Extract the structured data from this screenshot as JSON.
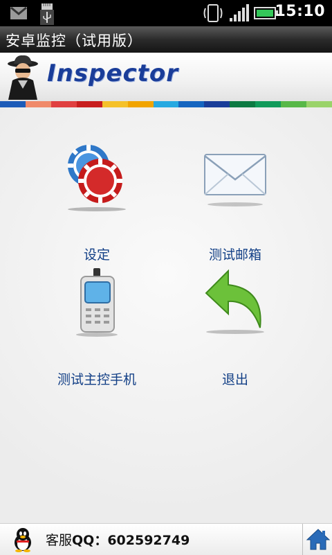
{
  "status_bar": {
    "time": "15:10",
    "icons": [
      "gmail-icon",
      "sd-card-icon",
      "usb-icon",
      "vibrate-icon",
      "signal-icon",
      "battery-icon"
    ]
  },
  "title_bar": {
    "title": "安卓监控（试用版）"
  },
  "brand": {
    "logo_text": "Inspector",
    "logo_icon": "spy-icon"
  },
  "stripe_colors": [
    "#1d5bb8",
    "#f08a6a",
    "#e04040",
    "#c81e1e",
    "#f5c12a",
    "#f1a400",
    "#27a9e1",
    "#1565c0",
    "#1a3d99",
    "#0d7a43",
    "#119a5a",
    "#58b848",
    "#9ad36a"
  ],
  "menu": {
    "settings": {
      "label": "设定",
      "icon": "poker-chips-icon"
    },
    "test_email": {
      "label": "测试邮箱",
      "icon": "envelope-icon"
    },
    "test_phone": {
      "label": "测试主控手机",
      "icon": "mobile-phone-icon"
    },
    "exit": {
      "label": "退出",
      "icon": "back-arrow-icon"
    }
  },
  "footer": {
    "service_prefix": "客服",
    "service_qq": "QQ：602592749",
    "qq_icon": "qq-penguin-icon",
    "home_icon": "home-icon"
  },
  "colors": {
    "label_blue": "#123f86",
    "logo_blue": "#1a3d99"
  }
}
